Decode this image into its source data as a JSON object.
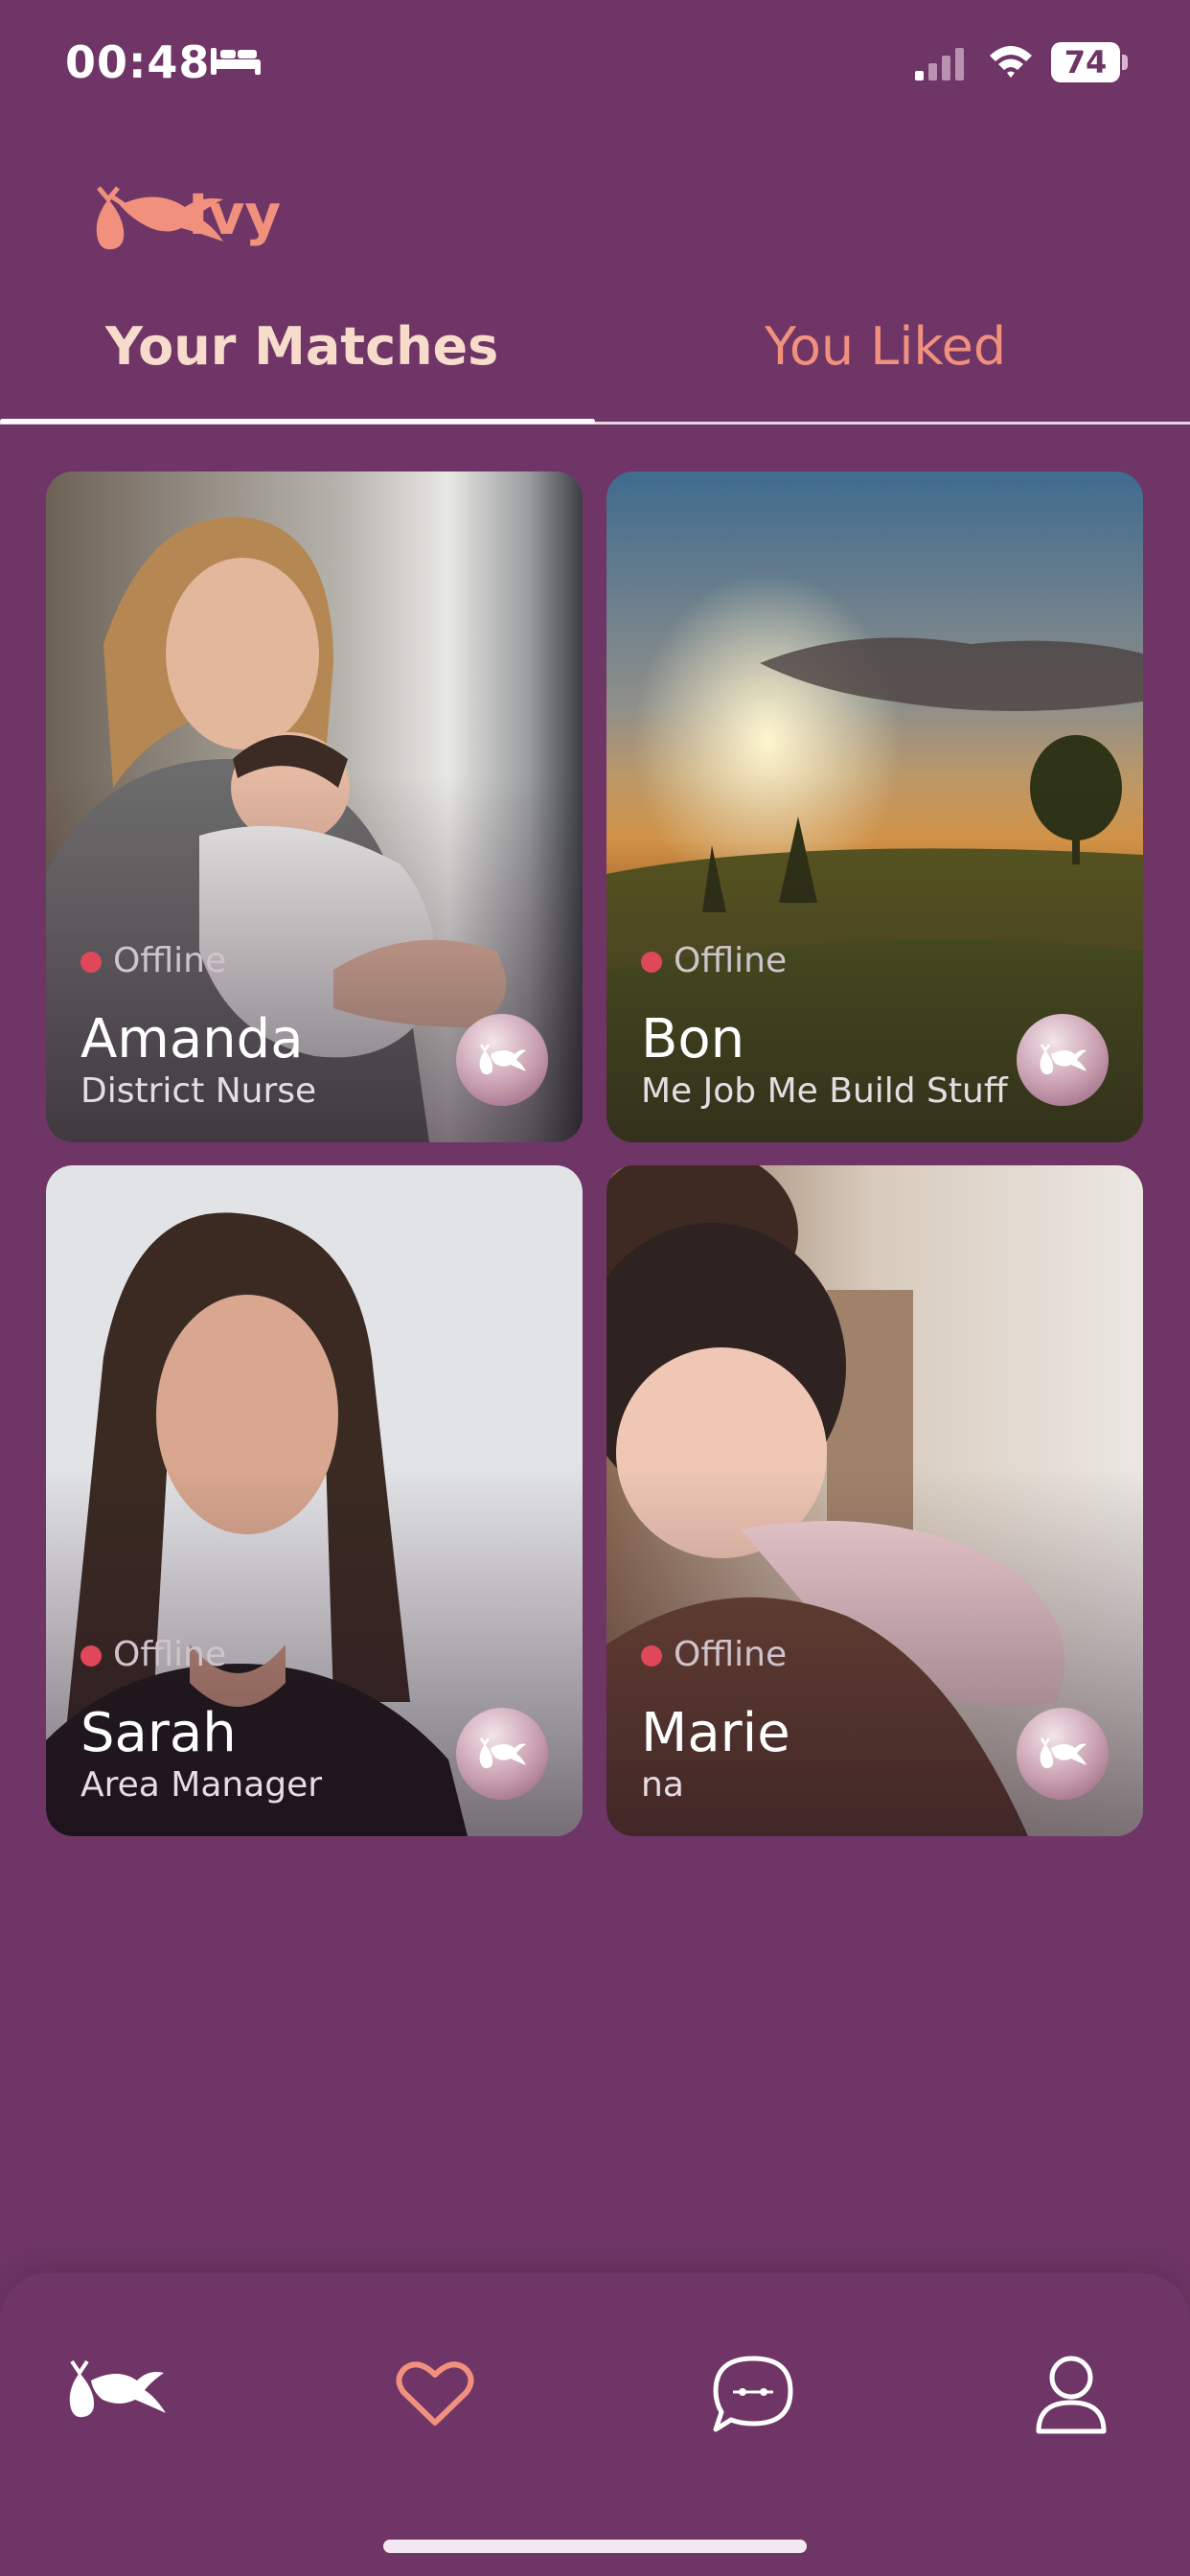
{
  "status_bar": {
    "time": "00:48",
    "battery": "74"
  },
  "app": {
    "name": "Ivy"
  },
  "tabs": [
    {
      "label": "Your Matches",
      "active": true
    },
    {
      "label": "You Liked",
      "active": false
    }
  ],
  "matches": [
    {
      "name": "Amanda",
      "role": "District Nurse",
      "status": "Offline"
    },
    {
      "name": "Bon",
      "role": "Me Job Me Build Stuff",
      "status": "Offline"
    },
    {
      "name": "Sarah",
      "role": "Area Manager",
      "status": "Offline"
    },
    {
      "name": "Marie",
      "role": "na",
      "status": "Offline"
    }
  ],
  "colors": {
    "background": "#6e3566",
    "accent": "#f1917d",
    "tab_active": "#f7dccc",
    "offline_dot": "#e0485a"
  },
  "icons": [
    "bed-icon",
    "signal-icon",
    "wifi-icon",
    "battery-icon",
    "stork-icon",
    "heart-icon",
    "chat-icon",
    "profile-icon"
  ]
}
